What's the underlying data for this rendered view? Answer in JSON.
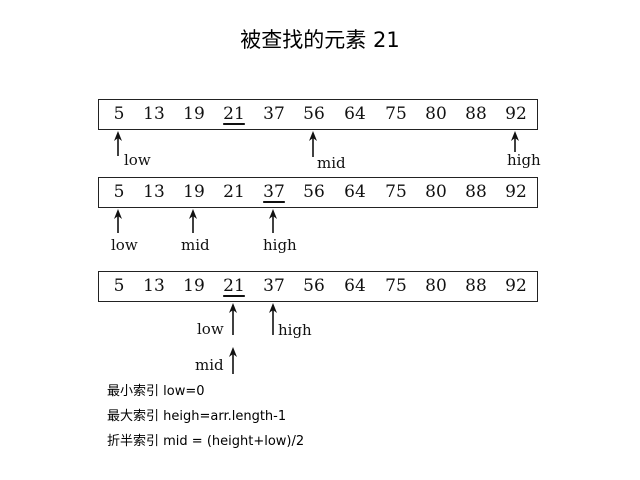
{
  "title": "被查找的元素 21",
  "rows": [
    {
      "values": [
        "5",
        "13",
        "19",
        "21",
        "37",
        "56",
        "64",
        "75",
        "80",
        "88",
        "92"
      ],
      "underline_index": 3,
      "pointers": [
        {
          "label": "low",
          "index": 0
        },
        {
          "label": "mid",
          "index": 5
        },
        {
          "label": "high",
          "index": 10
        }
      ]
    },
    {
      "values": [
        "5",
        "13",
        "19",
        "21",
        "37",
        "56",
        "64",
        "75",
        "80",
        "88",
        "92"
      ],
      "underline_index": 4,
      "pointers": [
        {
          "label": "low",
          "index": 0
        },
        {
          "label": "mid",
          "index": 2
        },
        {
          "label": "high",
          "index": 4
        }
      ]
    },
    {
      "values": [
        "5",
        "13",
        "19",
        "21",
        "37",
        "56",
        "64",
        "75",
        "80",
        "88",
        "92"
      ],
      "underline_index": 3,
      "pointers": [
        {
          "label": "low",
          "index": 3
        },
        {
          "label": "high",
          "index": 4
        },
        {
          "label": "mid",
          "index": 3
        }
      ]
    }
  ],
  "notes": [
    "最小索引 low=0",
    "最大索引 heigh=arr.length-1",
    "折半索引 mid = (height+low)/2"
  ]
}
